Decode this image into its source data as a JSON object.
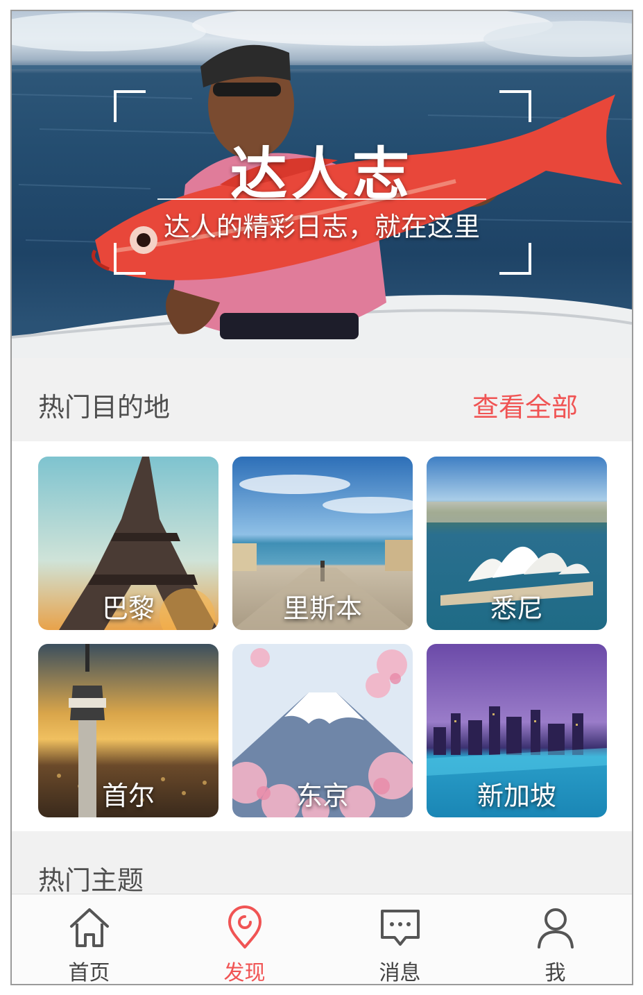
{
  "banner": {
    "title": "达人志",
    "subtitle": "达人的精彩日志，就在这里"
  },
  "hot_destinations": {
    "title": "热门目的地",
    "see_all": "查看全部",
    "items": [
      {
        "name": "巴黎",
        "icon": "eiffel-tower-photo"
      },
      {
        "name": "里斯本",
        "icon": "lisbon-square-photo"
      },
      {
        "name": "悉尼",
        "icon": "sydney-opera-house-photo"
      },
      {
        "name": "首尔",
        "icon": "seoul-tower-photo"
      },
      {
        "name": "东京",
        "icon": "mount-fuji-photo"
      },
      {
        "name": "新加坡",
        "icon": "singapore-pool-photo"
      }
    ]
  },
  "hot_topics": {
    "title": "热门主题"
  },
  "tabbar": {
    "items": [
      {
        "label": "首页",
        "icon": "home-icon",
        "active": false
      },
      {
        "label": "发现",
        "icon": "location-pin-icon",
        "active": true
      },
      {
        "label": "消息",
        "icon": "message-icon",
        "active": false
      },
      {
        "label": "我",
        "icon": "user-icon",
        "active": false
      }
    ],
    "active_color": "#f05454",
    "inactive_color": "#444444"
  },
  "colors": {
    "accent": "#f05454",
    "section_bg": "#f1f1f1"
  }
}
